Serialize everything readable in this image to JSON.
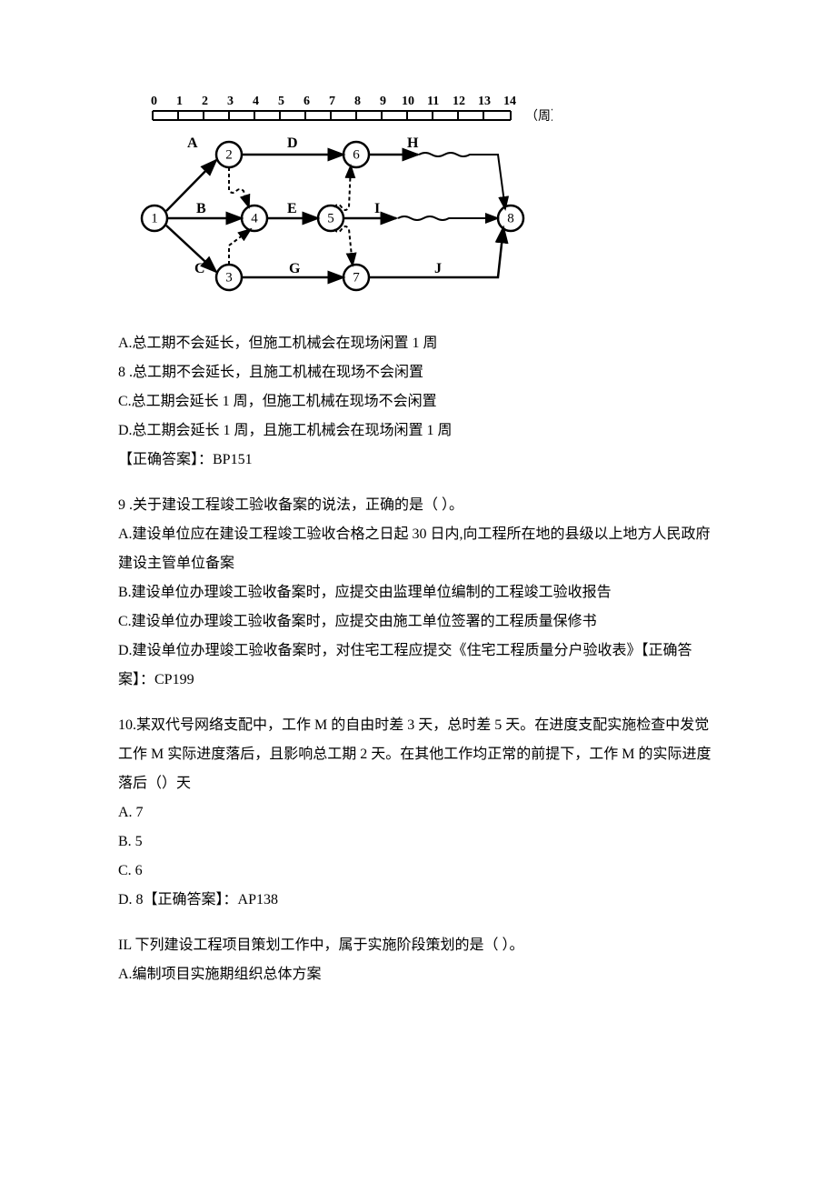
{
  "chart_data": {
    "type": "diagram",
    "description": "time-scaled network diagram",
    "time_axis": {
      "min": 0,
      "max": 14,
      "unit": "（周）",
      "ticks": [
        0,
        1,
        2,
        3,
        4,
        5,
        6,
        7,
        8,
        9,
        10,
        11,
        12,
        13,
        14
      ]
    },
    "nodes": [
      1,
      2,
      3,
      4,
      5,
      6,
      7,
      8
    ],
    "activities": [
      {
        "label": "A",
        "from": 1,
        "to": 2
      },
      {
        "label": "B",
        "from": 1,
        "to": 4
      },
      {
        "label": "C",
        "from": 1,
        "to": 3
      },
      {
        "label": "D",
        "from": 2,
        "to": 6
      },
      {
        "label": "E",
        "from": 4,
        "to": 5
      },
      {
        "label": "G",
        "from": 3,
        "to": 7
      },
      {
        "label": "H",
        "from": 6,
        "to": 8
      },
      {
        "label": "I",
        "from": 5,
        "to": 8
      },
      {
        "label": "J",
        "from": 7,
        "to": 8
      }
    ],
    "dummies": [
      {
        "from": 2,
        "to": 4
      },
      {
        "from": 3,
        "to": 4
      },
      {
        "from": 5,
        "to": 6
      },
      {
        "from": 5,
        "to": 7
      }
    ]
  },
  "q8": {
    "A": "A.总工期不会延长，但施工机械会在现场闲置 1 周",
    "B": "8  .总工期不会延长，且施工机械在现场不会闲置",
    "C": "C.总工期会延长 1 周，但施工机械在现场不会闲置",
    "D": "D.总工期会延长 1 周，且施工机械会在现场闲置 1 周",
    "answer": "【正确答案】：BP151"
  },
  "q9": {
    "stem": "9  .关于建设工程竣工验收备案的说法，正确的是（      ）。",
    "A": "A.建设单位应在建设工程竣工验收合格之日起 30 日内,向工程所在地的县级以上地方人民政府建设主管单位备案",
    "B": "B.建设单位办理竣工验收备案时，应提交由监理单位编制的工程竣工验收报告",
    "C": "C.建设单位办理竣工验收备案时，应提交由施工单位签署的工程质量保修书",
    "D": "D.建设单位办理竣工验收备案时，对住宅工程应提交《住宅工程质量分户验收表》【正确答案】：CP199"
  },
  "q10": {
    "stem": "10.某双代号网络支配中，工作 M 的自由时差 3 天，总时差 5 天。在进度支配实施检查中发觉工作 M 实际进度落后，且影响总工期 2 天。在其他工作均正常的前提下，工作 M 的实际进度落后（）天",
    "A": "A.   7",
    "B": "B.   5",
    "C": "C.   6",
    "D": "D.   8【正确答案】：AP138"
  },
  "q11": {
    "stem": "IL 下列建设工程项目策划工作中，属于实施阶段策划的是（         ）。",
    "A": "A.编制项目实施期组织总体方案"
  }
}
